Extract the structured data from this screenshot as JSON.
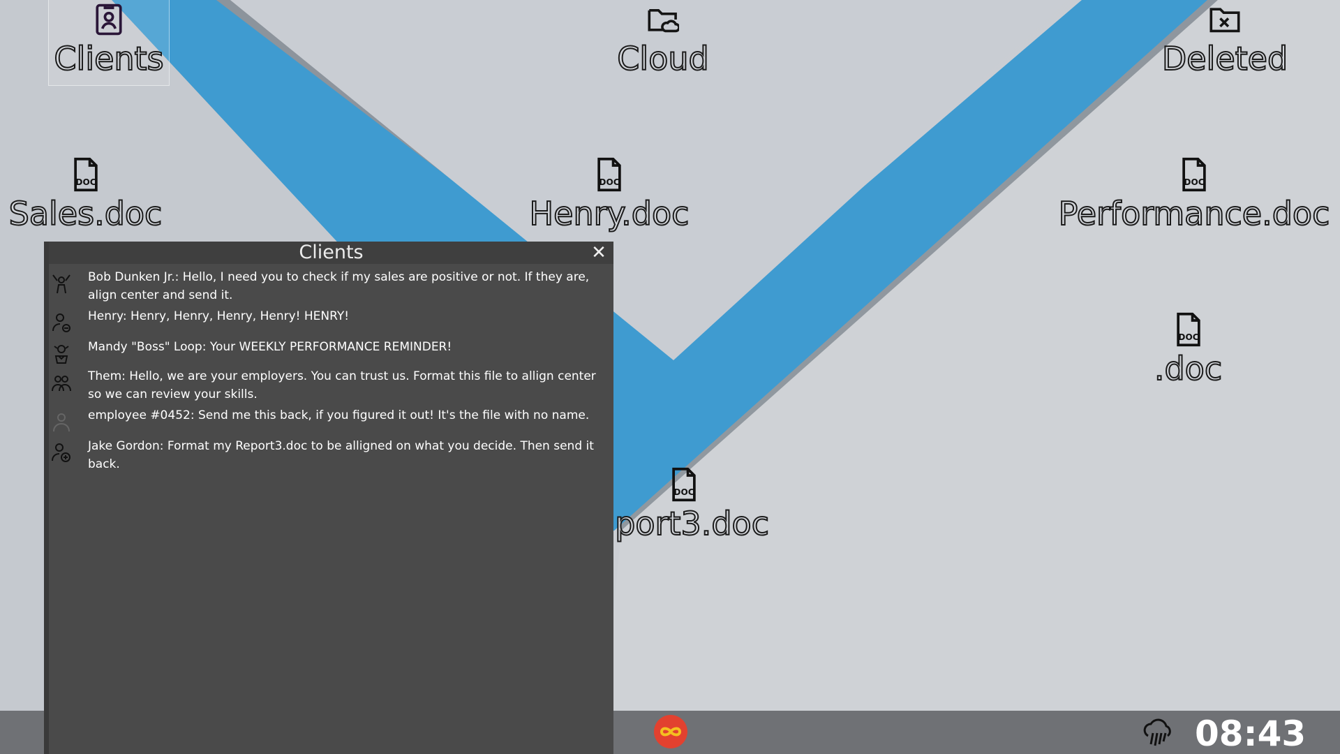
{
  "desktop": {
    "icons": [
      {
        "label": "Clients",
        "icon": "contact-folder-icon"
      },
      {
        "label": "Cloud",
        "icon": "cloud-folder-icon"
      },
      {
        "label": "Deleted",
        "icon": "deleted-folder-icon"
      },
      {
        "label": "Sales.doc",
        "icon": "doc-file-icon"
      },
      {
        "label": "Henry.doc",
        "icon": "doc-file-icon"
      },
      {
        "label": "Performance.doc",
        "icon": "doc-file-icon"
      },
      {
        "label": ".doc",
        "icon": "doc-file-icon"
      },
      {
        "label": "port3.doc",
        "icon": "doc-file-icon"
      }
    ],
    "doc_badge": "DOC"
  },
  "clients_window": {
    "title": "Clients",
    "close_label": "✕",
    "messages": [
      {
        "text": "Bob Dunken Jr.: Hello, I need you to check if my sales are positive or not. If they are, align center and send it.",
        "avatar": "cheering-person-icon"
      },
      {
        "text": "Henry: Henry, Henry, Henry, Henry! HENRY!",
        "avatar": "person-settings-icon"
      },
      {
        "text": "Mandy \"Boss\" Loop: Your WEEKLY PERFORMANCE REMINDER!",
        "avatar": "boss-person-icon"
      },
      {
        "text": "Them: Hello, we are your employers. You can trust us. Format this file to allign center so we can review your skills.",
        "avatar": "group-icon"
      },
      {
        "text": "employee #0452: Send me this back, if you figured it out! It's the file with no name.",
        "avatar": "faded-person-icon"
      },
      {
        "text": "Jake Gordon: Format my Report3.doc to be alligned on what you decide. Then send it back.",
        "avatar": "person-add-icon"
      }
    ]
  },
  "taskbar": {
    "center_icon": "infinity-icon",
    "weather_icon": "rain-cloud-icon",
    "clock": "08:43"
  },
  "colors": {
    "wallpaper": "#c8ccd2",
    "stripe": "#3f9bd0",
    "window_bg": "#4a4a4a",
    "taskbar": "#6f7175",
    "center_button": "#e2412f",
    "infinity": "#f4c020"
  }
}
